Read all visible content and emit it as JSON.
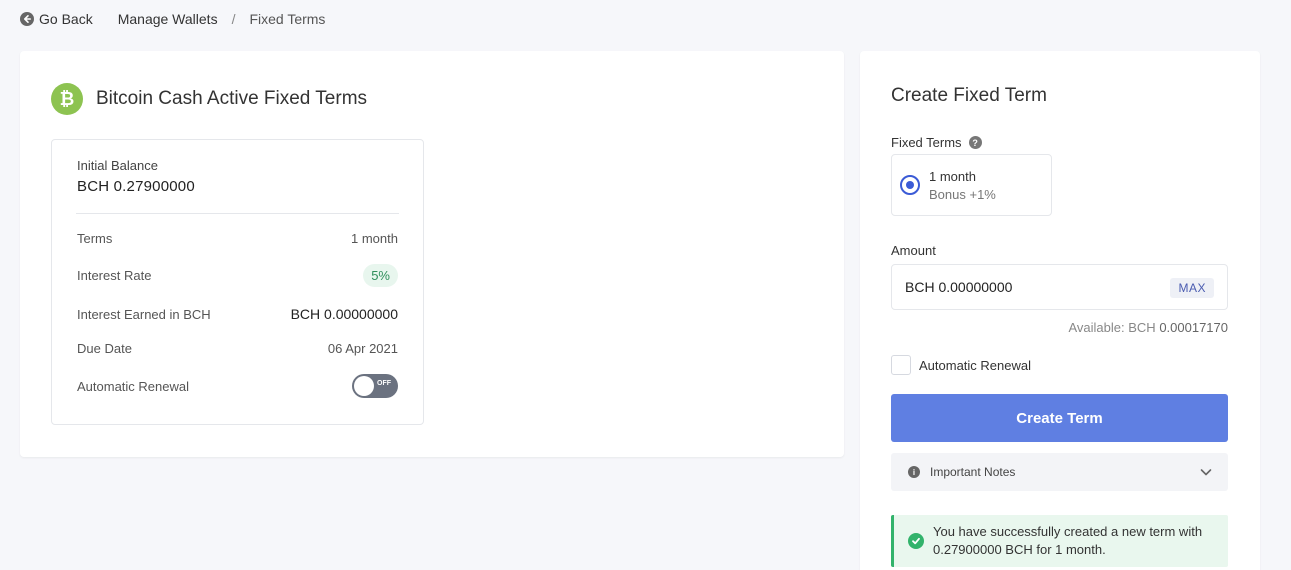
{
  "breadcrumb": {
    "back_label": "Go Back",
    "crumb_1": "Manage Wallets",
    "separator": "/",
    "current": "Fixed Terms"
  },
  "active_terms": {
    "coin_symbol_glyph": "₿",
    "coin_color": "#8dc351",
    "title": "Bitcoin Cash Active Fixed Terms",
    "term": {
      "initial_balance_label": "Initial Balance",
      "initial_balance_value": "BCH 0.27900000",
      "terms_label": "Terms",
      "terms_value": "1 month",
      "interest_rate_label": "Interest Rate",
      "interest_rate_value": "5%",
      "interest_earned_label": "Interest Earned in BCH",
      "interest_earned_value": "BCH 0.00000000",
      "due_date_label": "Due Date",
      "due_date_value": "06 Apr 2021",
      "auto_renewal_label": "Automatic Renewal",
      "auto_renewal_state": "OFF"
    }
  },
  "create_form": {
    "title": "Create Fixed Term",
    "fixed_terms_label": "Fixed Terms",
    "help_glyph": "?",
    "option": {
      "name": "1 month",
      "bonus": "Bonus +1%",
      "selected": true
    },
    "amount_label": "Amount",
    "amount_value": "BCH 0.00000000",
    "max_label": "MAX",
    "available_label": "Available: BCH",
    "available_value": "0.00017170",
    "auto_renewal_label": "Automatic Renewal",
    "auto_renewal_checked": false,
    "submit_label": "Create Term",
    "notes_label": "Important Notes",
    "info_glyph": "i",
    "success_message": "You have successfully created a new term with 0.27900000 BCH for 1 month."
  },
  "colors": {
    "accent": "#5f7fe2",
    "success": "#32b36b",
    "bch_green": "#8dc351"
  }
}
